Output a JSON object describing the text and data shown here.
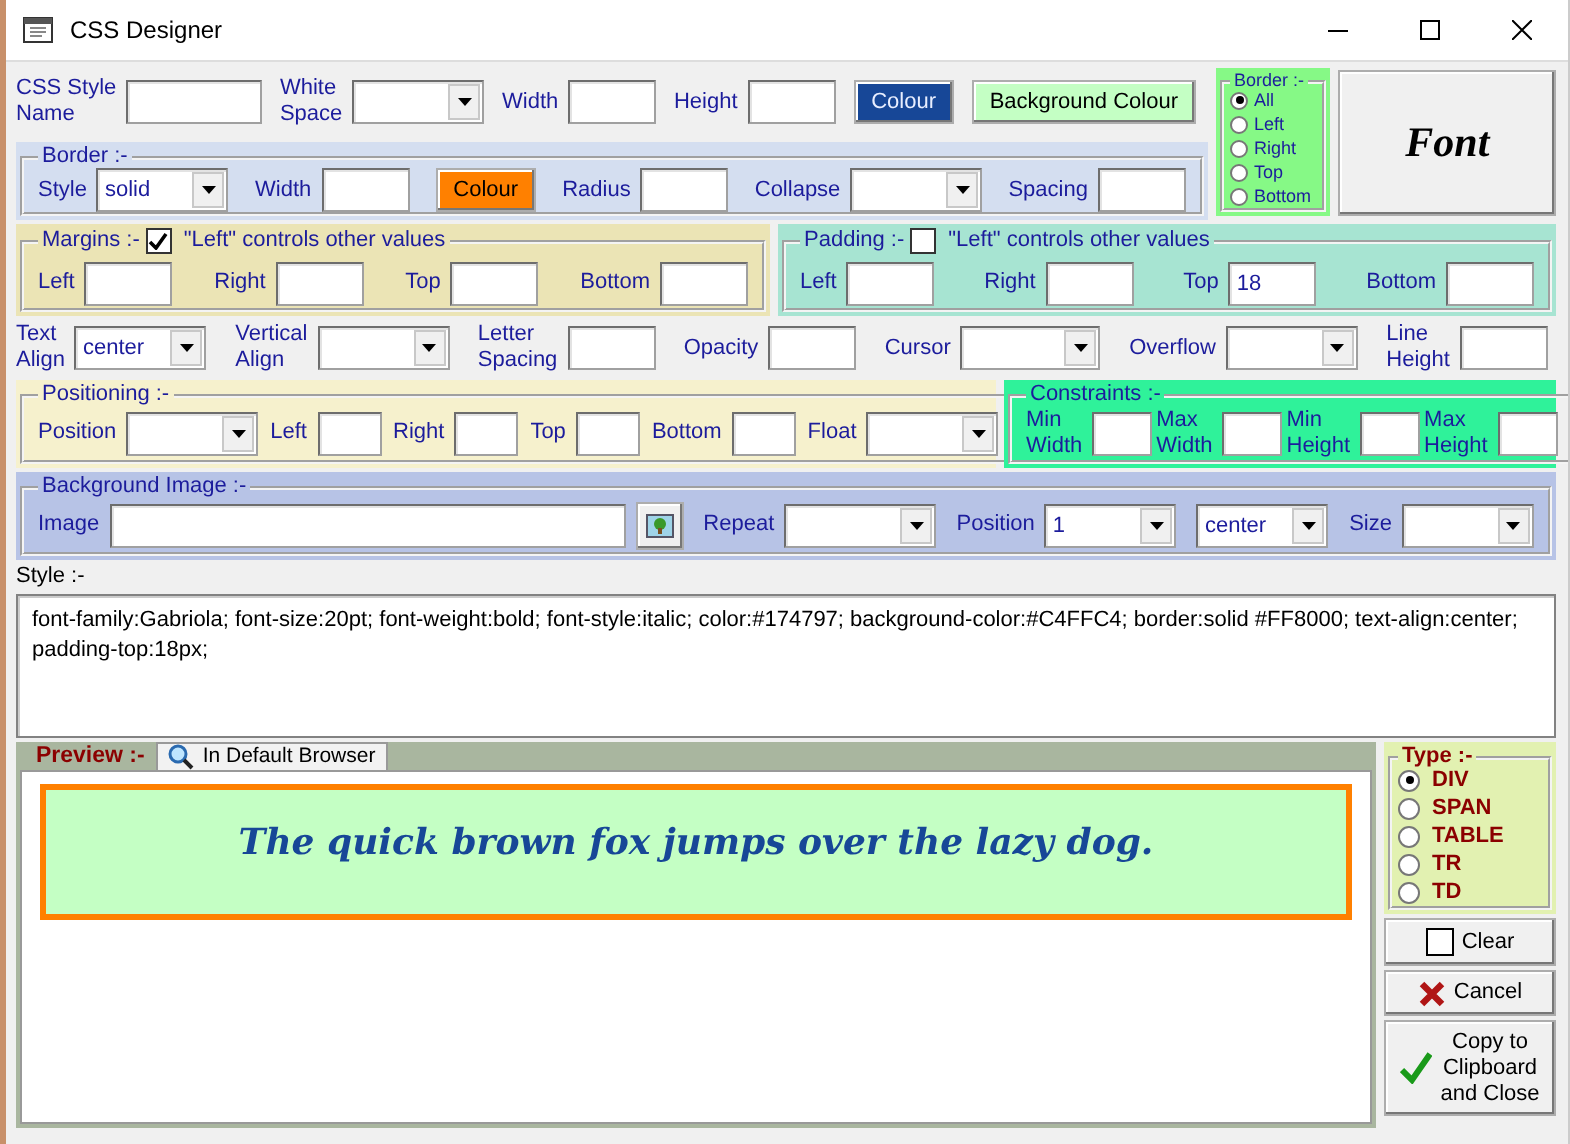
{
  "window": {
    "title": "CSS Designer"
  },
  "general": {
    "fields": [
      {
        "kind": "text",
        "label": "CSS Style\nName"
      },
      {
        "kind": "select",
        "label": "White\nSpace"
      },
      {
        "kind": "text",
        "label": "Width"
      },
      {
        "kind": "text",
        "label": "Height"
      },
      {
        "kind": "color",
        "label": "Colour",
        "color": "#174797"
      },
      {
        "kind": "color",
        "label": "Background Colour",
        "color": "#c4ffc4"
      }
    ]
  },
  "border_sides": {
    "title": "Border :-",
    "options": [
      {
        "label": "All",
        "selected": true
      },
      {
        "label": "Left",
        "selected": false
      },
      {
        "label": "Right",
        "selected": false
      },
      {
        "label": "Top",
        "selected": false
      },
      {
        "label": "Bottom",
        "selected": false
      }
    ]
  },
  "font_button": {
    "label": "Font"
  },
  "border": {
    "title": "Border :-",
    "fields": [
      {
        "kind": "select",
        "label": "Style",
        "value": "solid"
      },
      {
        "kind": "text",
        "label": "Width"
      },
      {
        "kind": "color",
        "label": "Colour",
        "color": "#ff8000"
      },
      {
        "kind": "text",
        "label": "Radius"
      },
      {
        "kind": "select",
        "label": "Collapse"
      },
      {
        "kind": "text",
        "label": "Spacing"
      }
    ]
  },
  "margins": {
    "title": "Margins :-",
    "link": {
      "label": "\"Left\" controls other values",
      "checked": true
    },
    "fields": [
      {
        "kind": "text",
        "label": "Left"
      },
      {
        "kind": "text",
        "label": "Right"
      },
      {
        "kind": "text",
        "label": "Top"
      },
      {
        "kind": "text",
        "label": "Bottom"
      }
    ]
  },
  "padding": {
    "title": "Padding :-",
    "link": {
      "label": "\"Left\" controls other values",
      "checked": false
    },
    "fields": [
      {
        "kind": "text",
        "label": "Left"
      },
      {
        "kind": "text",
        "label": "Right"
      },
      {
        "kind": "text",
        "label": "Top",
        "value": "18"
      },
      {
        "kind": "text",
        "label": "Bottom"
      }
    ]
  },
  "text": {
    "fields": [
      {
        "kind": "select",
        "label": "Text\nAlign",
        "value": "center"
      },
      {
        "kind": "select",
        "label": "Vertical\nAlign"
      },
      {
        "kind": "text",
        "label": "Letter\nSpacing"
      },
      {
        "kind": "text",
        "label": "Opacity"
      },
      {
        "kind": "select",
        "label": "Cursor"
      },
      {
        "kind": "select",
        "label": "Overflow"
      },
      {
        "kind": "text",
        "label": "Line\nHeight"
      }
    ]
  },
  "positioning": {
    "title": "Positioning :-",
    "fields": [
      {
        "kind": "select",
        "label": "Position"
      },
      {
        "kind": "text",
        "label": "Left"
      },
      {
        "kind": "text",
        "label": "Right"
      },
      {
        "kind": "text",
        "label": "Top"
      },
      {
        "kind": "text",
        "label": "Bottom"
      },
      {
        "kind": "select",
        "label": "Float"
      }
    ]
  },
  "constraints": {
    "title": "Constraints :-",
    "fields": [
      {
        "kind": "text",
        "label": "Min\nWidth"
      },
      {
        "kind": "text",
        "label": "Max\nWidth"
      },
      {
        "kind": "text",
        "label": "Min\nHeight"
      },
      {
        "kind": "text",
        "label": "Max\nHeight"
      }
    ]
  },
  "background_image": {
    "title": "Background Image :-",
    "fields": [
      {
        "kind": "file",
        "label": "Image"
      },
      {
        "kind": "select",
        "label": "Repeat"
      },
      {
        "kind": "select",
        "label": "Position",
        "value": "1"
      },
      {
        "kind": "select",
        "value": "center"
      },
      {
        "kind": "select",
        "label": "Size"
      }
    ]
  },
  "style": {
    "label": "Style :-",
    "value": "font-family:Gabriola; font-size:20pt; font-weight:bold; font-style:italic; color:#174797; background-color:#C4FFC4; border:solid #FF8000; text-align:center; padding-top:18px;"
  },
  "preview": {
    "title": "Preview :-",
    "browser_button": "In Default Browser",
    "sample": "The quick brown fox jumps over the lazy dog."
  },
  "type": {
    "title": "Type :-",
    "options": [
      {
        "label": "DIV",
        "selected": true
      },
      {
        "label": "SPAN",
        "selected": false
      },
      {
        "label": "TABLE",
        "selected": false
      },
      {
        "label": "TR",
        "selected": false
      },
      {
        "label": "TD",
        "selected": false
      }
    ]
  },
  "actions": [
    {
      "kind": "clear",
      "label": "Clear"
    },
    {
      "kind": "cancel",
      "label": "Cancel"
    },
    {
      "kind": "copy",
      "label": "Copy to\nClipboard\nand Close"
    }
  ]
}
